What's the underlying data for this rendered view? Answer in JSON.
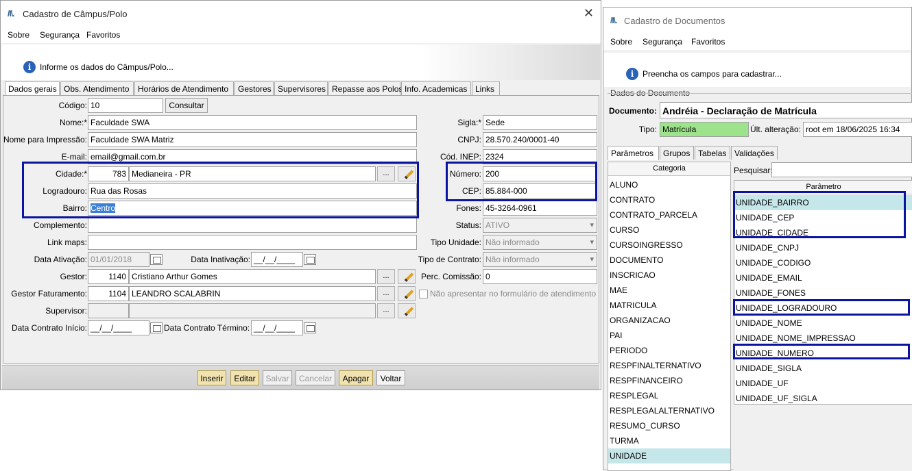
{
  "win1": {
    "title": "Cadastro de Câmpus/Polo",
    "logo": "/I\\.",
    "close": "✕",
    "menu": [
      "Sobre",
      "Segurança",
      "Favoritos"
    ],
    "info": "Informe os dados do Câmpus/Polo...",
    "tabs": [
      "Dados gerais",
      "Obs. Atendimento",
      "Horários de Atendimento",
      "Gestores",
      "Supervisores",
      "Repasse aos Polos",
      "Info. Academicas",
      "Links"
    ],
    "labels": {
      "codigo": "Código:",
      "nome": "Nome:*",
      "nome_impressao": "Nome para Impressão:",
      "email": "E-mail:",
      "cidade": "Cidade:*",
      "logradouro": "Logradouro:",
      "bairro": "Bairro:",
      "complemento": "Complemento:",
      "link_maps": "Link maps:",
      "data_ativacao": "Data Ativação:",
      "data_inativacao": "Data Inativação:",
      "gestor": "Gestor:",
      "gestor_faturamento": "Gestor Faturamento:",
      "supervisor": "Supervisor:",
      "data_contrato_inicio": "Data Contrato Início:",
      "data_contrato_termino": "Data Contrato Término:",
      "sigla": "Sigla:*",
      "cnpj": "CNPJ:",
      "cod_inep": "Cód. INEP:",
      "numero": "Número:",
      "cep": "CEP:",
      "fones": "Fones:",
      "status": "Status:",
      "tipo_unidade": "Tipo Unidade:",
      "tipo_contrato": "Tipo de Contrato:",
      "perc_comissao": "Perc. Comissão:"
    },
    "values": {
      "codigo": "10",
      "nome": "Faculdade SWA",
      "nome_impressao": "Faculdade SWA Matriz",
      "email": "email@gmail.com.br",
      "cidade_cod": "783",
      "cidade_nome": "Medianeira - PR",
      "logradouro": "Rua das Rosas",
      "bairro": "Centro",
      "complemento": "",
      "link_maps": "",
      "data_ativacao": "01/01/2018",
      "data_inativacao": "__/__/____",
      "gestor_cod": "1140",
      "gestor_nome": "Cristiano Arthur Gomes",
      "gestor_fat_cod": "1104",
      "gestor_fat_nome": "LEANDRO SCALABRIN",
      "supervisor_cod": "",
      "supervisor_nome": "",
      "data_contrato_inicio": "__/__/____",
      "data_contrato_termino": "__/__/____",
      "sigla": "Sede",
      "cnpj": "28.570.240/0001-40",
      "cod_inep": "2324",
      "numero": "200",
      "cep": "85.884-000",
      "fones": "45-3264-0961",
      "status": "ATIVO",
      "tipo_unidade": "Não informado",
      "tipo_contrato": "Não informado",
      "perc_comissao": "0"
    },
    "consultar": "Consultar",
    "ellipsis": "...",
    "nao_apresentar": "Não apresentar no formulário de atendimento",
    "buttons": [
      "Inserir",
      "Editar",
      "Salvar",
      "Cancelar",
      "Apagar",
      "Voltar"
    ]
  },
  "win2": {
    "title": "Cadastro de Documentos",
    "logo": "/I\\.",
    "menu": [
      "Sobre",
      "Segurança",
      "Favoritos"
    ],
    "info": "Preencha os campos para cadastrar...",
    "group_title": "Dados do Documento",
    "doc_label": "Documento:",
    "doc_value": "Andréia - Declaração de Matrícula",
    "tipo_label": "Tipo:",
    "tipo_value": "Matrícula",
    "ult_label": "Últ. alteração:",
    "ult_value": "root em 18/06/2025 16:34",
    "tabs": [
      "Parâmetros",
      "Grupos",
      "Tabelas",
      "Validações"
    ],
    "categoria_header": "Categoria",
    "categorias": [
      "ALUNO",
      "CONTRATO",
      "CONTRATO_PARCELA",
      "CURSO",
      "CURSOINGRESSO",
      "DOCUMENTO",
      "INSCRICAO",
      "MAE",
      "MATRICULA",
      "ORGANIZACAO",
      "PAI",
      "PERIODO",
      "RESPFINALTERNATIVO",
      "RESPFINANCEIRO",
      "RESPLEGAL",
      "RESPLEGALALTERNATIVO",
      "RESUMO_CURSO",
      "TURMA",
      "UNIDADE"
    ],
    "pesquisar_label": "Pesquisar:",
    "parametro_header": "Parâmetro",
    "parametros": [
      "UNIDADE_BAIRRO",
      "UNIDADE_CEP",
      "UNIDADE_CIDADE",
      "UNIDADE_CNPJ",
      "UNIDADE_CODIGO",
      "UNIDADE_EMAIL",
      "UNIDADE_FONES",
      "UNIDADE_LOGRADOURO",
      "UNIDADE_NOME",
      "UNIDADE_NOME_IMPRESSAO",
      "UNIDADE_NUMERO",
      "UNIDADE_SIGLA",
      "UNIDADE_UF",
      "UNIDADE_UF_SIGLA"
    ]
  },
  "colors": {
    "highlight": "#0a14a0",
    "selected": "#c6e7ea",
    "tipo_bg": "#9de38b",
    "warm_button": "#f1e3b0"
  }
}
